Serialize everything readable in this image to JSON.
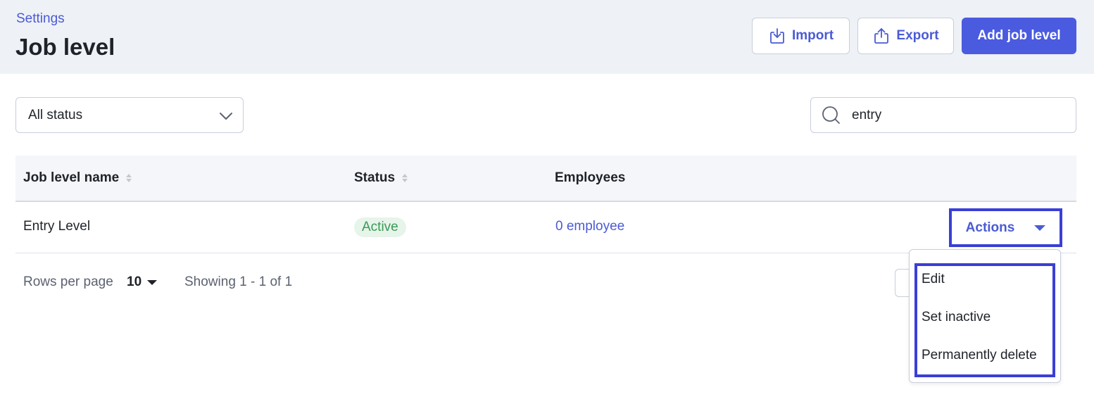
{
  "header": {
    "breadcrumb": "Settings",
    "title": "Job level",
    "import_label": "Import",
    "export_label": "Export",
    "add_label": "Add job level"
  },
  "filters": {
    "status_value": "All status",
    "search_value": "entry"
  },
  "table": {
    "columns": [
      "Job level name",
      "Status",
      "Employees"
    ],
    "rows": [
      {
        "name": "Entry Level",
        "status": "Active",
        "employees": "0 employee",
        "actions_label": "Actions"
      }
    ]
  },
  "footer": {
    "rows_per_page_label": "Rows per page",
    "rows_per_page_value": "10",
    "showing": "Showing 1 - 1 of 1"
  },
  "actions_menu": {
    "items": [
      "Edit",
      "Set inactive",
      "Permanently delete"
    ]
  },
  "colors": {
    "accent": "#4a5bd4",
    "primary_button": "#4a5be0",
    "highlight_border": "#3a3fd6",
    "active_badge_bg": "#e6f4ea",
    "active_badge_text": "#3a9a56"
  }
}
